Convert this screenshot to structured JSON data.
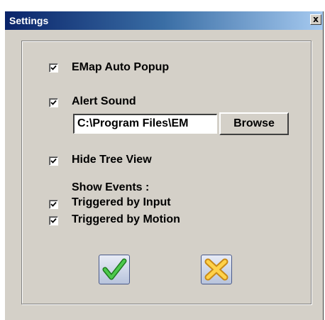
{
  "window": {
    "title": "Settings",
    "close_label": "x"
  },
  "options": {
    "emap_auto_popup": {
      "label": "EMap Auto Popup",
      "checked": true
    },
    "alert_sound": {
      "label": "Alert Sound",
      "checked": true
    },
    "sound_path": {
      "value": "C:\\Program Files\\EM"
    },
    "browse_label": "Browse",
    "hide_tree_view": {
      "label": "Hide Tree View",
      "checked": true
    },
    "show_events_label": "Show Events :",
    "triggered_by_input": {
      "label": "Triggered by Input",
      "checked": true
    },
    "triggered_by_motion": {
      "label": "Triggered by Motion",
      "checked": true
    }
  },
  "actions": {
    "ok_icon": "check-icon",
    "cancel_icon": "x-icon"
  }
}
